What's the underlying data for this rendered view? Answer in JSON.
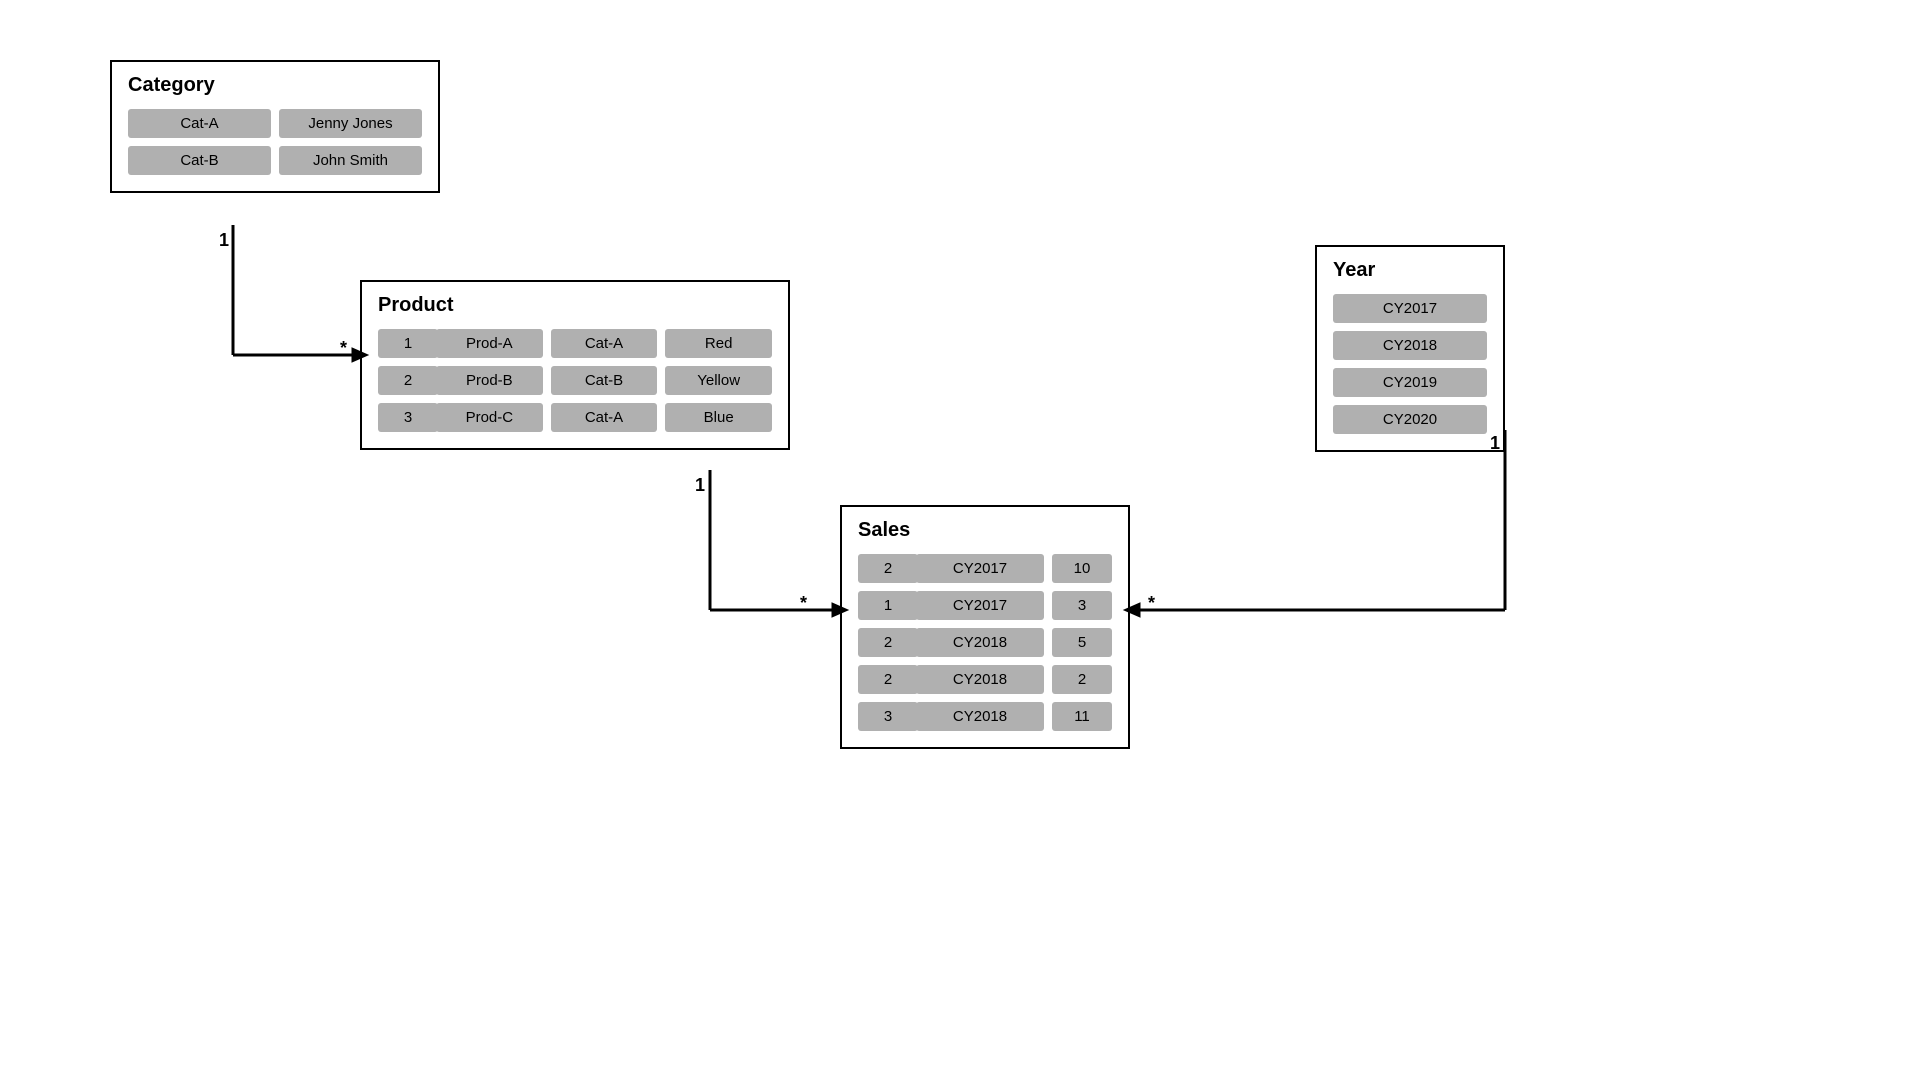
{
  "category": {
    "title": "Category",
    "rows": [
      [
        "Cat-A",
        "Jenny Jones"
      ],
      [
        "Cat-B",
        "John Smith"
      ]
    ]
  },
  "product": {
    "title": "Product",
    "rows": [
      [
        "1",
        "Prod-A",
        "Cat-A",
        "Red"
      ],
      [
        "2",
        "Prod-B",
        "Cat-B",
        "Yellow"
      ],
      [
        "3",
        "Prod-C",
        "Cat-A",
        "Blue"
      ]
    ]
  },
  "year": {
    "title": "Year",
    "rows": [
      "CY2017",
      "CY2018",
      "CY2019",
      "CY2020"
    ]
  },
  "sales": {
    "title": "Sales",
    "rows": [
      [
        "2",
        "CY2017",
        "10"
      ],
      [
        "1",
        "CY2017",
        "3"
      ],
      [
        "2",
        "CY2018",
        "5"
      ],
      [
        "2",
        "CY2018",
        "2"
      ],
      [
        "3",
        "CY2018",
        "11"
      ]
    ]
  },
  "relations": {
    "cat_to_prod": {
      "from": "1",
      "to": "*"
    },
    "prod_to_sales": {
      "from": "1",
      "to": "*"
    },
    "year_to_sales": {
      "from": "1",
      "to": "*"
    }
  }
}
